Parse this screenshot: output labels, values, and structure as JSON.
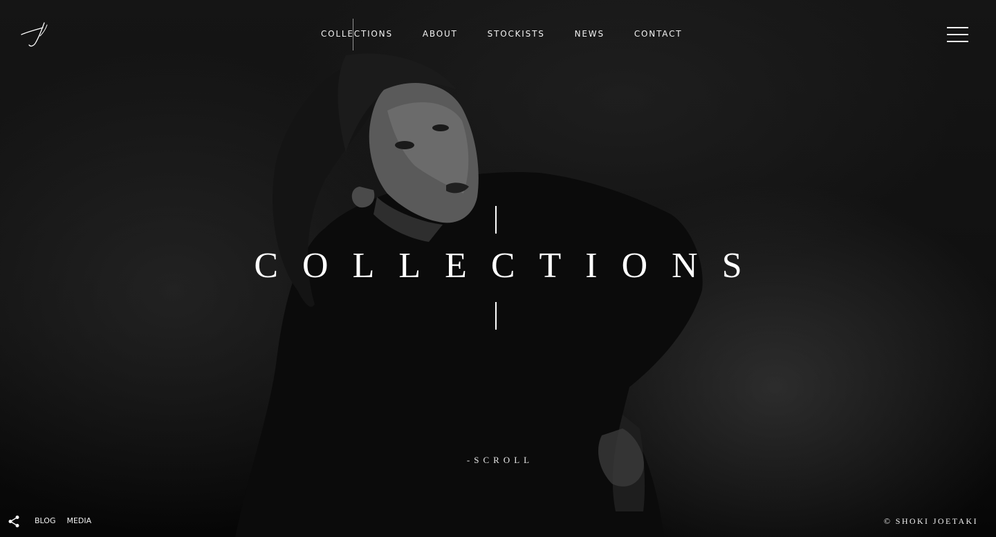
{
  "nav": {
    "items": [
      {
        "label": "COLLECTIONS",
        "active": true
      },
      {
        "label": "ABOUT"
      },
      {
        "label": "STOCKISTS"
      },
      {
        "label": "NEWS"
      },
      {
        "label": "CONTACT"
      }
    ]
  },
  "hero": {
    "title": "COLLECTIONS",
    "scroll_label": "-SCROLL"
  },
  "footer": {
    "links": [
      "BLOG",
      "MEDIA"
    ],
    "copyright": "© SHOKI JOETAKI"
  },
  "colors": {
    "background": "#050505",
    "text": "#ffffff"
  },
  "icons": {
    "logo": "signature-logo-icon",
    "menu": "hamburger-menu-icon",
    "share": "share-icon"
  }
}
